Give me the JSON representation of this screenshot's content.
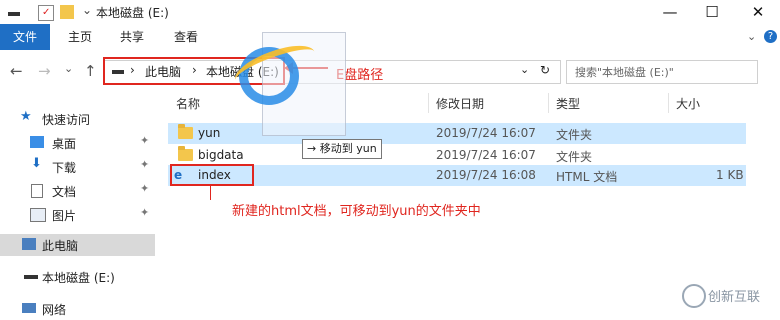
{
  "window": {
    "title": "本地磁盘 (E:)",
    "controls": {
      "minimize": "—",
      "maximize": "☐",
      "close": "✕"
    }
  },
  "ribbon": {
    "file": "文件",
    "tabs": [
      "主页",
      "共享",
      "查看"
    ],
    "expand": "⌄",
    "help": "?"
  },
  "nav": {
    "back": "←",
    "forward": "→",
    "dropdown": "⌄",
    "up": "↑"
  },
  "address": {
    "crumbs": [
      "此电脑",
      "本地磁盘 (E:)"
    ],
    "separator": "›",
    "refresh": "↻",
    "dropdown": "⌄"
  },
  "search": {
    "placeholder": "搜索\"本地磁盘 (E:)\""
  },
  "sidebar": {
    "quick_access": "快速访问",
    "items": [
      {
        "label": "桌面",
        "pinned": true
      },
      {
        "label": "下载",
        "pinned": true
      },
      {
        "label": "文档",
        "pinned": true
      },
      {
        "label": "图片",
        "pinned": true
      }
    ],
    "this_pc": "此电脑",
    "local_disk": "本地磁盘 (E:)",
    "network": "网络",
    "pin_glyph": "📌"
  },
  "list": {
    "headers": {
      "name": "名称",
      "modified": "修改日期",
      "type": "类型",
      "size": "大小"
    },
    "rows": [
      {
        "name": "yun",
        "modified": "2019/7/24 16:07",
        "type": "文件夹",
        "size": "",
        "kind": "folder"
      },
      {
        "name": "bigdata",
        "modified": "2019/7/24 16:07",
        "type": "文件夹",
        "size": "",
        "kind": "folder"
      },
      {
        "name": "index",
        "modified": "2019/7/24 16:08",
        "type": "HTML 文档",
        "size": "1 KB",
        "kind": "html"
      }
    ]
  },
  "drag": {
    "tooltip": "移动到 yun",
    "arrow": "→"
  },
  "annotations": {
    "path_label": "E盘路径",
    "move_note": "新建的html文档，可移动到yun的文件夹中"
  },
  "watermark": {
    "text": "创新互联"
  },
  "colors": {
    "accent": "#1f6fc5",
    "annotation": "#e0261f",
    "selection": "#cce8ff",
    "folder": "#f3c64c"
  }
}
